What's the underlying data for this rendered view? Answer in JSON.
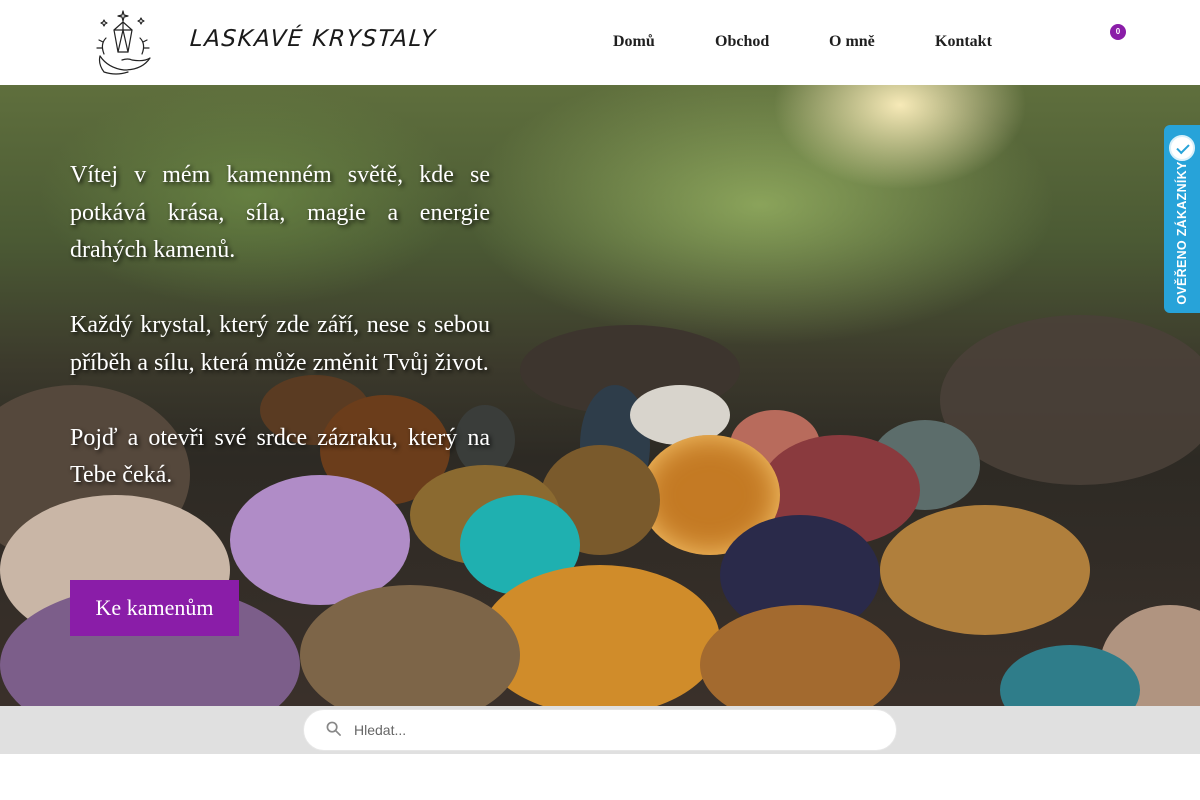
{
  "header": {
    "logo_text": "LASKAVÉ KRYSTALY",
    "nav": [
      {
        "label": "Domů"
      },
      {
        "label": "Obchod"
      },
      {
        "label": "O mně"
      },
      {
        "label": "Kontakt"
      }
    ],
    "cart": {
      "icon": "cart-icon",
      "count": "0",
      "glyph": ""
    }
  },
  "hero": {
    "paragraphs": [
      "Vítej v mém kamenném světě, kde se potkává krása, síla, magie a energie drahých kamenů.",
      "Každý krystal, který zde září, nese s sebou příběh a sílu, která může změnit Tvůj život.",
      "Pojď a otevři své srdce zázraku, který na Tebe čeká."
    ],
    "cta_label": "Ke kamenům"
  },
  "verified_badge": {
    "label": "OVĚŘENO ZÁKAZNÍKY",
    "color": "#27a3d9"
  },
  "search": {
    "placeholder": "Hledat...",
    "value": ""
  },
  "colors": {
    "accent": "#8a1da8",
    "badge_blue": "#27a3d9"
  }
}
